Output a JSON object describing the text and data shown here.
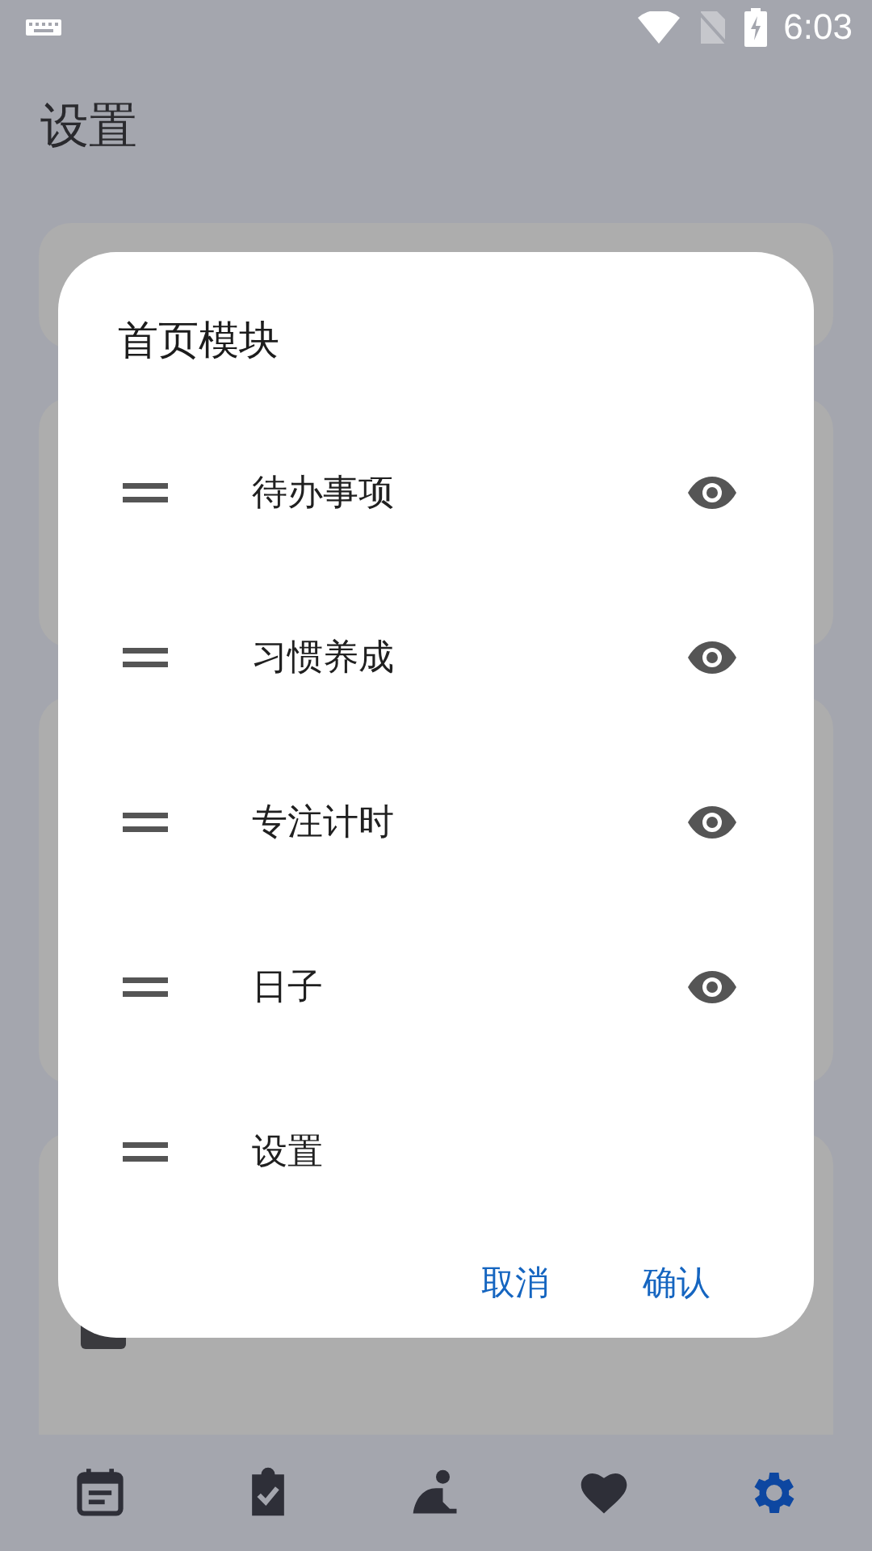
{
  "status_bar": {
    "time": "6:03"
  },
  "page": {
    "title": "设置"
  },
  "dialog": {
    "title": "首页模块",
    "items": [
      {
        "label": "待办事项",
        "visible": true
      },
      {
        "label": "习惯养成",
        "visible": true
      },
      {
        "label": "专注计时",
        "visible": true
      },
      {
        "label": "日子",
        "visible": true
      },
      {
        "label": "设置",
        "visible": false
      }
    ],
    "buttons": [
      "取消",
      "确认"
    ]
  },
  "bottom_nav": [
    {
      "kind": "calendar",
      "selected": false
    },
    {
      "kind": "clipboard",
      "selected": false
    },
    {
      "kind": "focus",
      "selected": false
    },
    {
      "kind": "heart",
      "selected": false
    },
    {
      "kind": "settings",
      "selected": true
    }
  ]
}
